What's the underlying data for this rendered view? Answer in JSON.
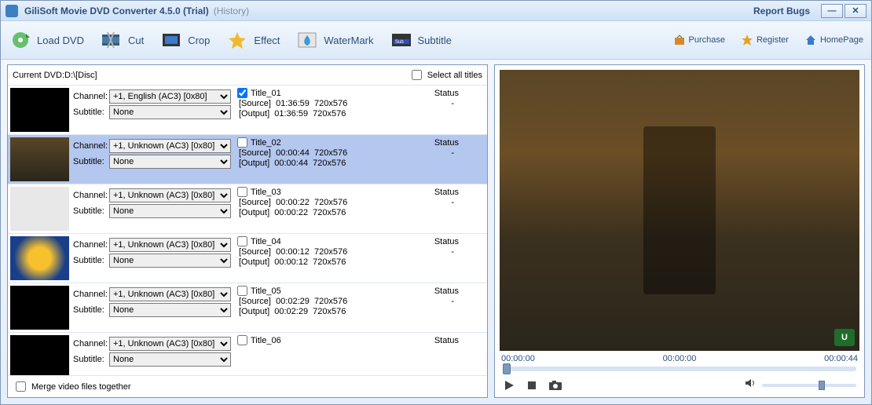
{
  "titlebar": {
    "title": "GiliSoft Movie DVD Converter 4.5.0 (Trial)",
    "history": "(History)",
    "report": "Report Bugs"
  },
  "toolbar": {
    "load": "Load DVD",
    "cut": "Cut",
    "crop": "Crop",
    "effect": "Effect",
    "watermark": "WaterMark",
    "subtitle": "Subtitle",
    "purchase": "Purchase",
    "register": "Register",
    "homepage": "HomePage"
  },
  "left": {
    "current": "Current DVD:D:\\[Disc]",
    "selectall": "Select all titles",
    "merge": "Merge video files together",
    "labels": {
      "channel": "Channel:",
      "subtitle": "Subtitle:",
      "source": "[Source]",
      "output": "[Output]",
      "status": "Status"
    },
    "subtitle_option": "None",
    "titles": [
      {
        "name": "Title_01",
        "channel": "+1, English (AC3) [0x80]",
        "dur": "01:36:59",
        "res": "720x576",
        "status": "-",
        "checked": true
      },
      {
        "name": "Title_02",
        "channel": "+1, Unknown (AC3) [0x80]",
        "dur": "00:00:44",
        "res": "720x576",
        "status": "-",
        "checked": false,
        "selected": true
      },
      {
        "name": "Title_03",
        "channel": "+1, Unknown (AC3) [0x80]",
        "dur": "00:00:22",
        "res": "720x576",
        "status": "-",
        "checked": false
      },
      {
        "name": "Title_04",
        "channel": "+1, Unknown (AC3) [0x80]",
        "dur": "00:00:12",
        "res": "720x576",
        "status": "-",
        "checked": false
      },
      {
        "name": "Title_05",
        "channel": "+1, Unknown (AC3) [0x80]",
        "dur": "00:02:29",
        "res": "720x576",
        "status": "-",
        "checked": false
      },
      {
        "name": "Title_06",
        "channel": "+1, Unknown (AC3) [0x80]",
        "dur": "",
        "res": "",
        "status": "-",
        "checked": false
      }
    ]
  },
  "preview": {
    "t0": "00:00:00",
    "t1": "00:00:00",
    "t2": "00:00:44"
  }
}
